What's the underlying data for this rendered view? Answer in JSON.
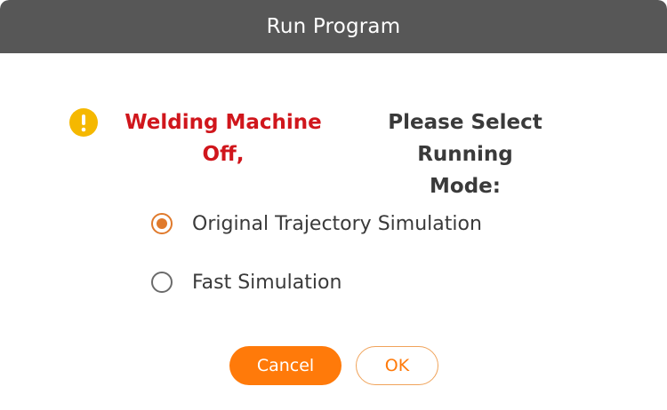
{
  "dialog": {
    "title": "Run Program"
  },
  "message": {
    "icon": "warning-circle-icon",
    "icon_color": "#f5b800",
    "alert_line1": "Welding Machine",
    "alert_line2": "Off,",
    "alert_color": "#d0161c",
    "prompt_line1": "Please Select Running",
    "prompt_line2": "Mode:"
  },
  "options": [
    {
      "label": "Original Trajectory Simulation",
      "selected": true
    },
    {
      "label": "Fast Simulation",
      "selected": false
    }
  ],
  "buttons": {
    "cancel_label": "Cancel",
    "ok_label": "OK",
    "accent": "#ff7a0a"
  }
}
